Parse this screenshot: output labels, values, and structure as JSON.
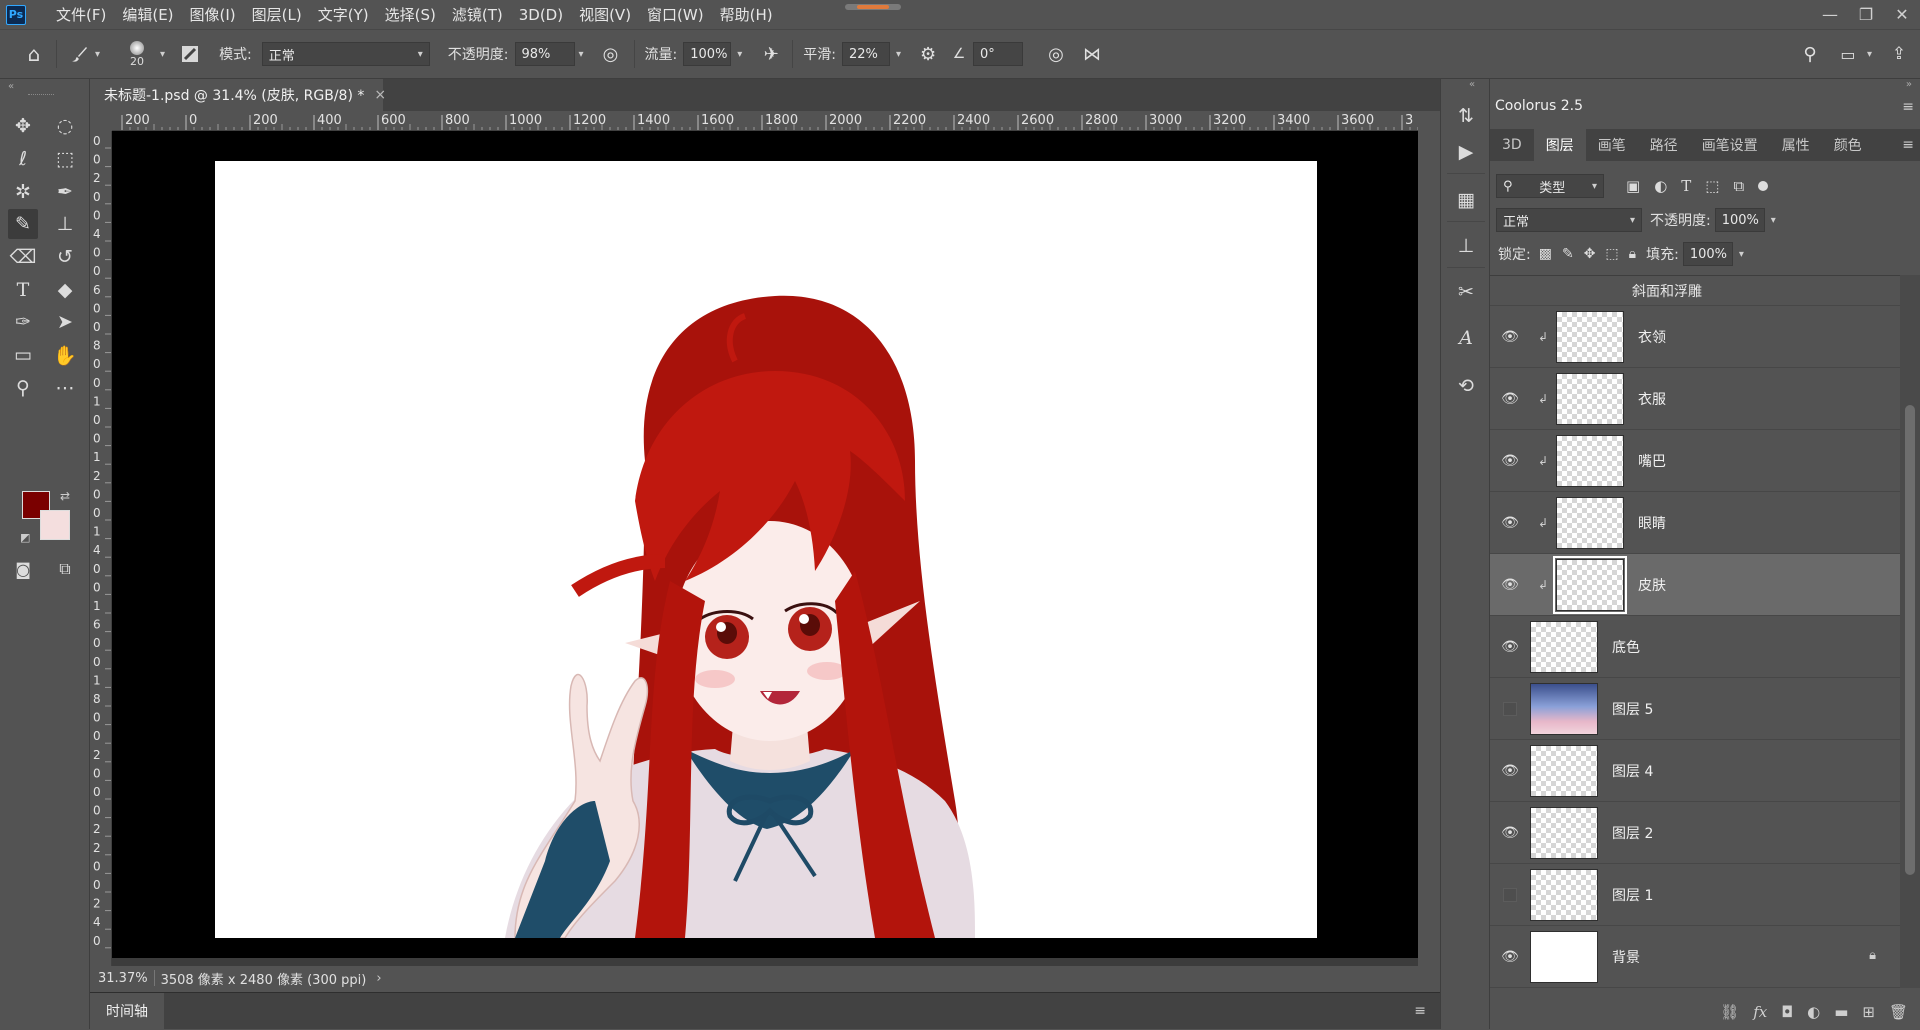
{
  "menubar": {
    "logo": "Ps",
    "items": [
      "文件(F)",
      "编辑(E)",
      "图像(I)",
      "图层(L)",
      "文字(Y)",
      "选择(S)",
      "滤镜(T)",
      "3D(D)",
      "视图(V)",
      "窗口(W)",
      "帮助(H)"
    ]
  },
  "window_buttons": {
    "minimize": "—",
    "restore": "❐",
    "close": "✕"
  },
  "options": {
    "brush_size": "20",
    "mode_label": "模式:",
    "mode_value": "正常",
    "opacity_label": "不透明度:",
    "opacity_value": "98%",
    "flow_label": "流量:",
    "flow_value": "100%",
    "smooth_label": "平滑:",
    "smooth_value": "22%",
    "angle_value": "0°"
  },
  "document": {
    "tab_title": "未标题-1.psd @ 31.4% (皮肤, RGB/8) *",
    "zoom": "31.37%",
    "doc_info": "3508 像素 x 2480 像素 (300 ppi)",
    "ruler_h": [
      "200",
      "0",
      "200",
      "400",
      "600",
      "800",
      "1000",
      "1200",
      "1400",
      "1600",
      "1800",
      "2000",
      "2200",
      "2400",
      "2600",
      "2800",
      "3000",
      "3200",
      "3400",
      "3600",
      "3"
    ],
    "ruler_v": [
      "0",
      "0",
      "2",
      "0",
      "0",
      "4",
      "0",
      "0",
      "6",
      "0",
      "0",
      "8",
      "0",
      "0",
      "1",
      "0",
      "0",
      "1",
      "2",
      "0",
      "0",
      "1",
      "4",
      "0",
      "0",
      "1",
      "6",
      "0",
      "0",
      "1",
      "8",
      "0",
      "0",
      "2",
      "0",
      "0",
      "0",
      "2",
      "2",
      "0",
      "0",
      "2",
      "4",
      "0"
    ]
  },
  "timeline": {
    "tab": "时间轴"
  },
  "panels": {
    "coolorus_tab": "Coolorus 2.5",
    "tabs": [
      "3D",
      "图层",
      "画笔",
      "路径",
      "画笔设置",
      "属性",
      "颜色"
    ],
    "active_tab": "图层",
    "filter_value": "类型",
    "blend_mode": "正常",
    "opacity_label": "不透明度:",
    "opacity_value": "100%",
    "lock_label": "锁定:",
    "fill_label": "填充:",
    "fill_value": "100%",
    "effect_label": "斜面和浮雕",
    "layers": [
      {
        "name": "衣领",
        "visible": true,
        "clipped": true,
        "thumb": "checker"
      },
      {
        "name": "衣服",
        "visible": true,
        "clipped": true,
        "thumb": "checker"
      },
      {
        "name": "嘴巴",
        "visible": true,
        "clipped": true,
        "thumb": "checker"
      },
      {
        "name": "眼睛",
        "visible": true,
        "clipped": true,
        "thumb": "checker"
      },
      {
        "name": "皮肤",
        "visible": true,
        "clipped": true,
        "thumb": "checker",
        "selected": true
      },
      {
        "name": "底色",
        "visible": true,
        "clipped": false,
        "thumb": "checker"
      },
      {
        "name": "图层 5",
        "visible": false,
        "clipped": false,
        "thumb": "sky"
      },
      {
        "name": "图层 4",
        "visible": true,
        "clipped": false,
        "thumb": "checker"
      },
      {
        "name": "图层 2",
        "visible": true,
        "clipped": false,
        "thumb": "checker"
      },
      {
        "name": "图层 1",
        "visible": false,
        "clipped": false,
        "thumb": "checker"
      },
      {
        "name": "背景",
        "visible": true,
        "clipped": false,
        "thumb": "solid",
        "locked": true
      }
    ]
  },
  "colors": {
    "foreground": "#7a0000",
    "background": "#f4dede",
    "hair": "#b8160e",
    "ribbon": "#1e4a66"
  }
}
